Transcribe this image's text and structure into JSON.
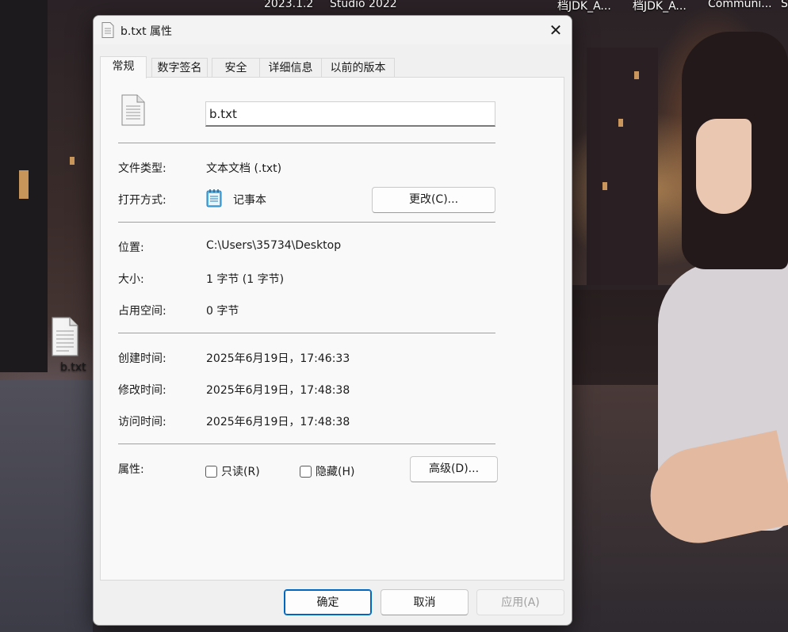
{
  "taskbar": {
    "items": [
      "2023.1.2",
      "Studio 2022",
      "档JDK_A...",
      "档JDK_A...",
      "Communi...",
      "S"
    ]
  },
  "desktop": {
    "icon_label": "b.txt"
  },
  "dialog": {
    "title": "b.txt 属性",
    "close_glyph": "✕",
    "tabs": [
      "常规",
      "数字签名",
      "安全",
      "详细信息",
      "以前的版本"
    ],
    "active_tab": "常规",
    "file_name": "b.txt",
    "fields": {
      "type_label": "文件类型:",
      "type_value": "文本文档 (.txt)",
      "open_with_label": "打开方式:",
      "open_with_value": "记事本",
      "change_button": "更改(C)...",
      "location_label": "位置:",
      "location_value": "C:\\Users\\35734\\Desktop",
      "size_label": "大小:",
      "size_value": "1 字节 (1 字节)",
      "disk_size_label": "占用空间:",
      "disk_size_value": "0 字节",
      "created_label": "创建时间:",
      "created_value": "2025年6月19日，17:46:33",
      "modified_label": "修改时间:",
      "modified_value": "2025年6月19日，17:48:38",
      "accessed_label": "访问时间:",
      "accessed_value": "2025年6月19日，17:48:38",
      "attributes_label": "属性:",
      "readonly_label": "只读(R)",
      "hidden_label": "隐藏(H)",
      "advanced_button": "高级(D)..."
    },
    "footer": {
      "ok": "确定",
      "cancel": "取消",
      "apply": "应用(A)"
    }
  },
  "colors": {
    "accent": "#0067c0",
    "disabled_text": "#9f9f9f"
  }
}
